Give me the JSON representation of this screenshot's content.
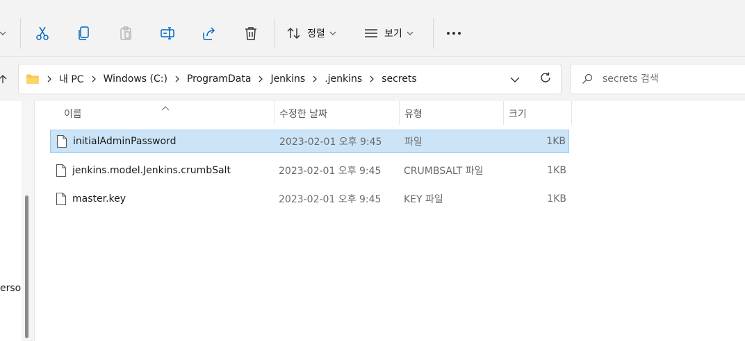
{
  "toolbar": {
    "sort_label": "정렬",
    "view_label": "보기",
    "icons": [
      "chevron-down-icon",
      "cut-icon",
      "copy-icon",
      "paste-icon",
      "rename-icon",
      "share-icon",
      "delete-icon",
      "sort-icon",
      "view-icon",
      "more-icon"
    ]
  },
  "address": {
    "crumbs": [
      "내 PC",
      "Windows (C:)",
      "ProgramData",
      "Jenkins",
      ".jenkins",
      "secrets"
    ]
  },
  "search": {
    "placeholder": "secrets 검색"
  },
  "nav_pane": {
    "partial_label": "erso"
  },
  "columns": {
    "name": "이름",
    "date": "수정한 날짜",
    "type": "유형",
    "size": "크기"
  },
  "files": [
    {
      "name": "initialAdminPassword",
      "date": "2023-02-01 오후 9:45",
      "type": "파일",
      "size": "1KB",
      "selected": true
    },
    {
      "name": "jenkins.model.Jenkins.crumbSalt",
      "date": "2023-02-01 오후 9:45",
      "type": "CRUMBSALT 파일",
      "size": "1KB",
      "selected": false
    },
    {
      "name": "master.key",
      "date": "2023-02-01 오후 9:45",
      "type": "KEY 파일",
      "size": "1KB",
      "selected": false
    }
  ],
  "colors": {
    "accent_icon": "#0067c0",
    "selection_bg": "#cce4f7",
    "folder": "#f8c94a"
  }
}
